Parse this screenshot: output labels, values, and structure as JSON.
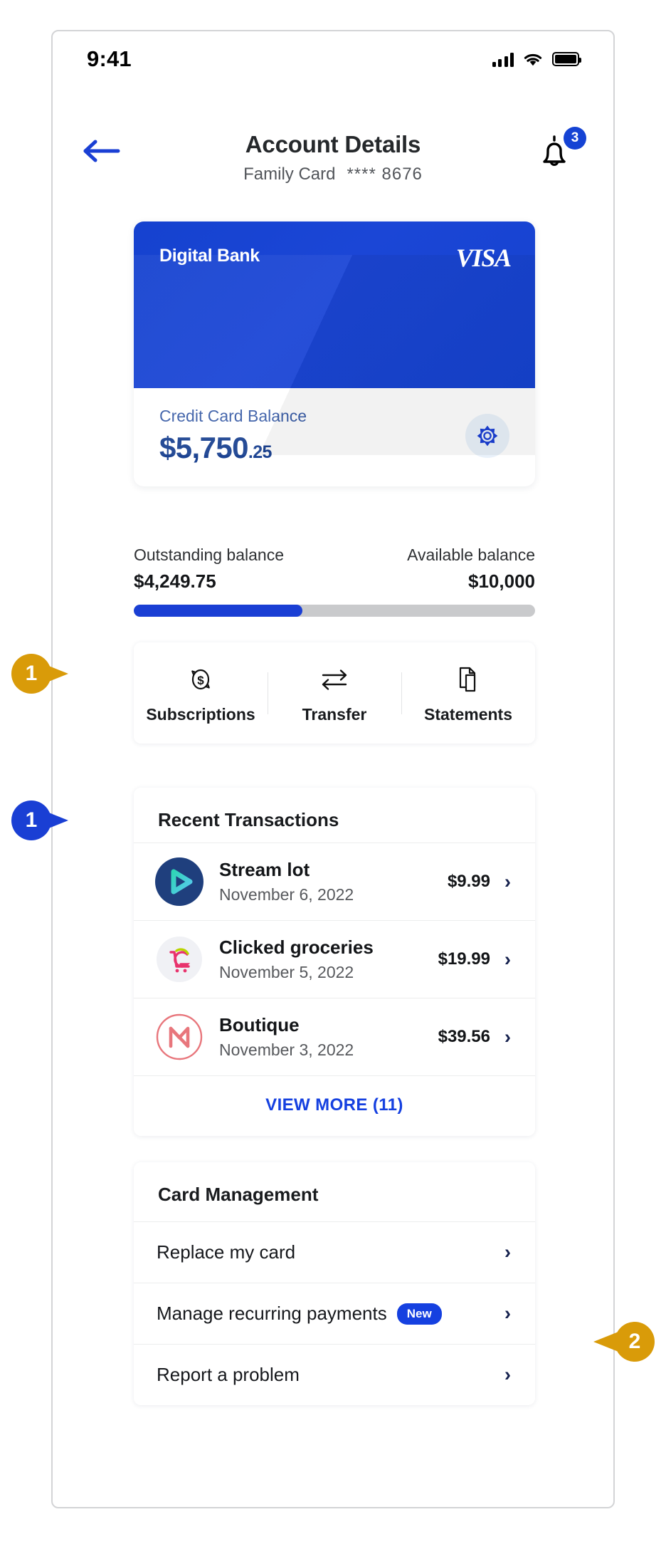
{
  "status_bar": {
    "time": "9:41",
    "signal_icon": "cellular-signal-icon",
    "wifi_icon": "wifi-icon",
    "battery_icon": "battery-icon"
  },
  "header": {
    "back_icon": "back-arrow-icon",
    "title": "Account Details",
    "card_name": "Family Card",
    "card_mask": "**** 8676",
    "bell_icon": "notification-bell-icon",
    "notification_count": "3"
  },
  "credit_card": {
    "bank_name": "Digital Bank",
    "network_logo": "VISA",
    "balance_label": "Credit Card Balance",
    "balance_main": "$5,750",
    "balance_cents": ".25",
    "settings_icon": "gear-icon",
    "card_color": "#1542cf"
  },
  "balances": {
    "outstanding_label": "Outstanding balance",
    "outstanding_value": "$4,249.75",
    "available_label": "Available balance",
    "available_value": "$10,000",
    "progress_percent": 42,
    "progress_color": "#1a3fd4",
    "track_color": "#c9cacc"
  },
  "actions": [
    {
      "label": "Subscriptions",
      "icon": "recurring-dollar-icon"
    },
    {
      "label": "Transfer",
      "icon": "transfer-arrows-icon"
    },
    {
      "label": "Statements",
      "icon": "documents-icon"
    }
  ],
  "transactions": {
    "heading": "Recent Transactions",
    "items": [
      {
        "merchant": "Stream lot",
        "date": "November 6, 2022",
        "amount": "$9.99",
        "logo": "stream-play-logo",
        "chevron": "chevron-right-icon"
      },
      {
        "merchant": "Clicked groceries",
        "date": "November 5, 2022",
        "amount": "$19.99",
        "logo": "grocery-cart-logo",
        "chevron": "chevron-right-icon"
      },
      {
        "merchant": "Boutique",
        "date": "November 3, 2022",
        "amount": "$39.56",
        "logo": "boutique-monogram-logo",
        "chevron": "chevron-right-icon"
      }
    ],
    "view_more": "VIEW MORE (11)"
  },
  "card_management": {
    "heading": "Card Management",
    "rows": [
      {
        "label": "Replace my card",
        "badge": "",
        "chevron": "chevron-right-icon"
      },
      {
        "label": "Manage recurring payments",
        "badge": "New",
        "chevron": "chevron-right-icon"
      },
      {
        "label": "Report a problem",
        "badge": "",
        "chevron": "chevron-right-icon"
      }
    ]
  },
  "callouts": [
    {
      "number": "1",
      "color": "#d99b09",
      "target": "subscriptions-action"
    },
    {
      "number": "1",
      "color": "#1a3fd4",
      "target": "transaction-stream-lot"
    },
    {
      "number": "2",
      "color": "#d99b09",
      "target": "manage-recurring-payments-row"
    }
  ]
}
